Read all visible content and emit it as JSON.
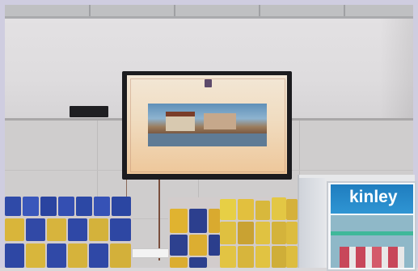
{
  "scene": {
    "fridge_brand": "kinley"
  },
  "colors": {
    "frame": "#cfcde0",
    "wall": "#dedcde",
    "tv_screen": "#f0dcc0",
    "fridge_panel": "#1f7dbf"
  }
}
